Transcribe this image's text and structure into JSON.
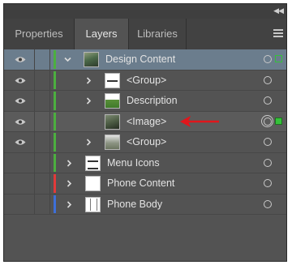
{
  "tabs": [
    {
      "label": "Properties",
      "active": false
    },
    {
      "label": "Layers",
      "active": true
    },
    {
      "label": "Libraries",
      "active": false
    }
  ],
  "icons": {
    "collapse": "double-chevron-icon",
    "panel_menu": "hamburger-menu-icon",
    "visibility": "eye-icon",
    "expand": "chevron-icon",
    "target": "target-circle-icon"
  },
  "colors": {
    "green_layer": "#4caf3f",
    "red_layer": "#e23a3a",
    "blue_layer": "#3d6fd8",
    "selection_square": "#35c23a",
    "annotation_arrow": "#e0161c"
  },
  "layers": [
    {
      "label": "Design Content",
      "selected": true
    },
    {
      "label": "<Group>"
    },
    {
      "label": "Description"
    },
    {
      "label": "<Image>",
      "highlighted": true
    },
    {
      "label": "<Group>"
    },
    {
      "label": "Menu Icons"
    },
    {
      "label": "Phone Content"
    },
    {
      "label": "Phone Body"
    }
  ]
}
